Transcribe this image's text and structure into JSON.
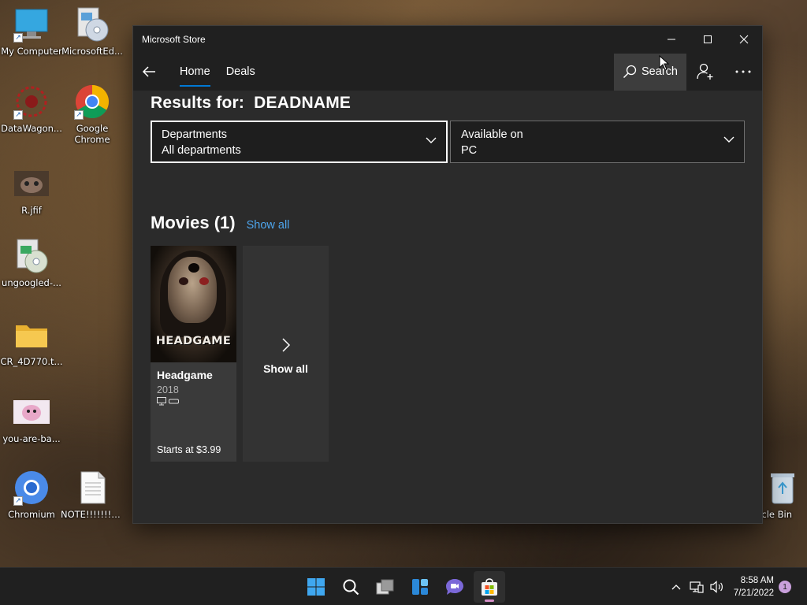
{
  "desktop": {
    "icons": [
      {
        "label": "My Computer"
      },
      {
        "label": "MicrosoftEd..."
      },
      {
        "label": "DataWagon..."
      },
      {
        "label": "Google Chrome"
      },
      {
        "label": "R.jfif"
      },
      {
        "label": "ungoogled-..."
      },
      {
        "label": "CR_4D770.t..."
      },
      {
        "label": "you-are-ba..."
      },
      {
        "label": "Chromium"
      },
      {
        "label": "NOTE!!!!!!!!!..."
      },
      {
        "label": "cycle Bin"
      }
    ]
  },
  "window": {
    "title": "Microsoft Store",
    "minimize_icon": "minimize-icon",
    "maximize_icon": "maximize-icon",
    "close_icon": "close-icon"
  },
  "nav": {
    "tabs": [
      {
        "label": "Home",
        "active": true
      },
      {
        "label": "Deals",
        "active": false
      }
    ],
    "search_label": "Search"
  },
  "results": {
    "prefix": "Results for:",
    "query": "DEADNAME",
    "filters": [
      {
        "label": "Departments",
        "value": "All departments"
      },
      {
        "label": "Available on",
        "value": "PC"
      }
    ]
  },
  "movies": {
    "title": "Movies (1)",
    "show_all_link": "Show all",
    "items": [
      {
        "poster_title": "HEADGAME",
        "name": "Headgame",
        "year": "2018",
        "platforms": [
          "pc-icon",
          "hololens-icon"
        ],
        "price": "Starts at $3.99"
      }
    ],
    "show_all_card": "Show all"
  },
  "taskbar": {
    "apps": [
      "start-icon",
      "search-icon",
      "task-view-icon",
      "widgets-icon",
      "chat-icon",
      "store-icon"
    ],
    "clock_time": "8:58 AM",
    "clock_date": "7/21/2022",
    "notification_count": "1"
  },
  "colors": {
    "accent": "#0078d4",
    "link": "#4ea6ee",
    "window_bg": "#2b2b2b"
  }
}
